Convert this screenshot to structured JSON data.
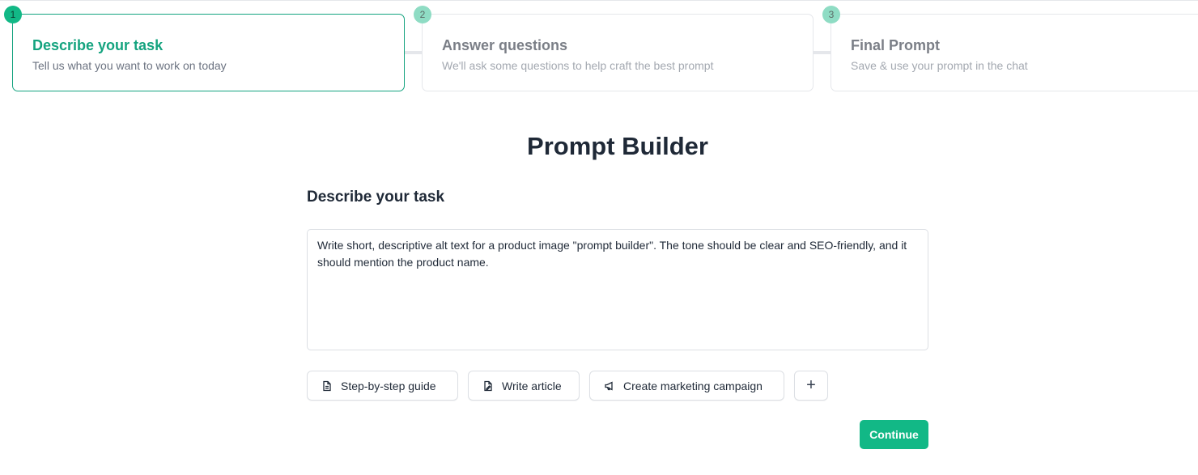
{
  "stepper": {
    "steps": [
      {
        "number": "1",
        "title": "Describe your task",
        "subtitle": "Tell us what you want to work on today",
        "state": "active"
      },
      {
        "number": "2",
        "title": "Answer questions",
        "subtitle": "We'll ask some questions to help craft the best prompt",
        "state": "inactive"
      },
      {
        "number": "3",
        "title": "Final Prompt",
        "subtitle": "Save & use your prompt in the chat",
        "state": "inactive"
      }
    ]
  },
  "main": {
    "title": "Prompt Builder",
    "section_title": "Describe your task",
    "task_value": "Write short, descriptive alt text for a product image \"prompt builder\". The tone should be clear and SEO-friendly, and it should mention the product name.",
    "chips": [
      {
        "label": "Step-by-step guide",
        "icon": "document-icon"
      },
      {
        "label": "Write article",
        "icon": "edit-document-icon"
      },
      {
        "label": "Create marketing campaign",
        "icon": "megaphone-icon"
      },
      {
        "label": "+",
        "icon": "plus-icon"
      }
    ],
    "continue_label": "Continue"
  },
  "colors": {
    "accent": "#12b886",
    "accent_text": "#14a37f",
    "border": "#dcdfe4",
    "step_badge_inactive": "#8fdcc4"
  }
}
